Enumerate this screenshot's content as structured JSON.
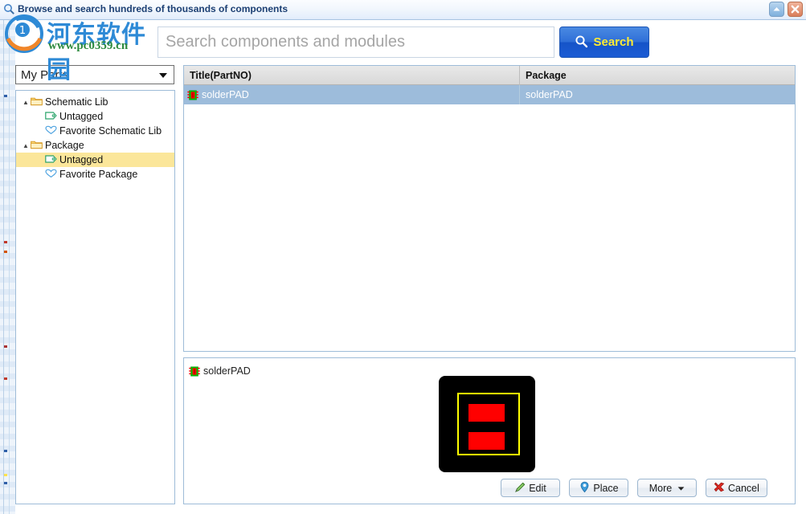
{
  "window": {
    "title": "Browse and search hundreds of thousands of components",
    "title_icon": "search-icon",
    "minimize_label": "",
    "close_label": ""
  },
  "search": {
    "placeholder": "Search components and modules",
    "value": "",
    "button_label": "Search",
    "button_icon": "magnifier-icon",
    "button_bg": "#2f6fd8",
    "button_text_color": "#ffec33"
  },
  "library_selector": {
    "value": "My Parts",
    "caret_icon": "chevron-down-icon"
  },
  "tree": {
    "items": [
      {
        "label": "Schematic Lib",
        "icon": "folder-icon",
        "indent": 0,
        "expanded": true,
        "selected": false
      },
      {
        "label": "Untagged",
        "icon": "tag-icon",
        "indent": 1,
        "expanded": false,
        "selected": false
      },
      {
        "label": "Favorite Schematic Lib",
        "icon": "heart-icon",
        "indent": 1,
        "expanded": false,
        "selected": false
      },
      {
        "label": "Package",
        "icon": "folder-icon",
        "indent": 0,
        "expanded": true,
        "selected": false
      },
      {
        "label": "Untagged",
        "icon": "tag-icon",
        "indent": 1,
        "expanded": false,
        "selected": true
      },
      {
        "label": "Favorite Package",
        "icon": "heart-icon",
        "indent": 1,
        "expanded": false,
        "selected": false
      }
    ],
    "selected_highlight": "#fbe69a"
  },
  "results": {
    "columns": [
      "Title(PartNO)",
      "Package"
    ],
    "rows": [
      {
        "title": "solderPAD",
        "package": "solderPAD",
        "icon": "component-chip-icon",
        "selected": true
      }
    ],
    "selected_row_bg": "#9dbcdb"
  },
  "preview": {
    "title": "solderPAD",
    "title_icon": "component-chip-icon",
    "artwork": {
      "background": "#000000",
      "outline_color": "#ffff00",
      "pad_color": "#ff0000",
      "pad_count": 2
    },
    "buttons": [
      {
        "label": "Edit",
        "icon": "pencil-icon"
      },
      {
        "label": "Place",
        "icon": "location-pin-icon"
      },
      {
        "label": "More",
        "icon": "chevron-down-icon"
      },
      {
        "label": "Cancel",
        "icon": "red-x-icon"
      }
    ]
  },
  "watermark": {
    "site_name": "河东软件园",
    "url": "www.pc0359.cn",
    "logo_icon": "circular-logo-icon"
  }
}
